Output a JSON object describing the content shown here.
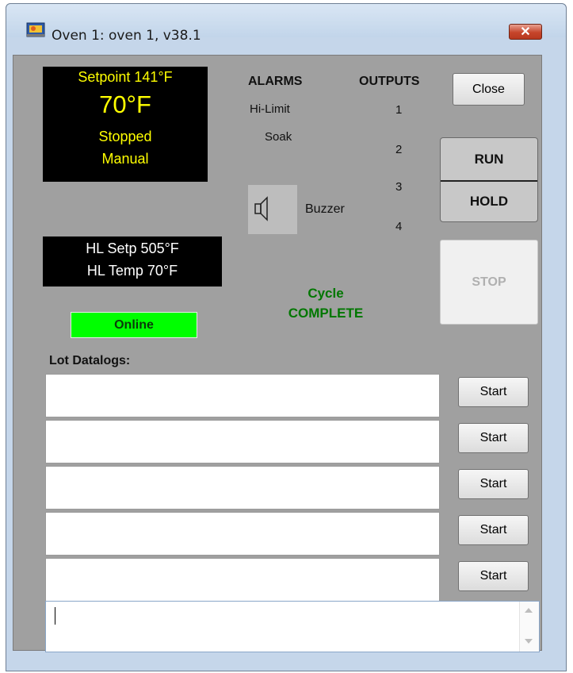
{
  "window": {
    "title": "Oven 1: oven 1, v38.1"
  },
  "display": {
    "setpoint": "Setpoint 141°F",
    "temperature": "70°F",
    "state": "Stopped",
    "mode": "Manual",
    "hl_setpoint": "HL Setp 505°F",
    "hl_temp": "HL Temp 70°F",
    "online": "Online"
  },
  "alarms": {
    "header": "ALARMS",
    "items": [
      "Hi-Limit",
      "Soak"
    ],
    "buzzer_label": "Buzzer"
  },
  "outputs": {
    "header": "OUTPUTS",
    "items": [
      "1",
      "2",
      "3",
      "4"
    ]
  },
  "cycle": {
    "line1": "Cycle",
    "line2": "COMPLETE"
  },
  "buttons": {
    "close": "Close",
    "run": "RUN",
    "hold": "HOLD",
    "stop": "STOP",
    "start": "Start"
  },
  "lots": {
    "label": "Lot Datalogs:"
  },
  "colors": {
    "display_bg": "#000000",
    "display_text": "#ffff00",
    "online_bg": "#00ff00",
    "cycle_text": "#007700",
    "panel_bg": "#a0a0a0"
  }
}
